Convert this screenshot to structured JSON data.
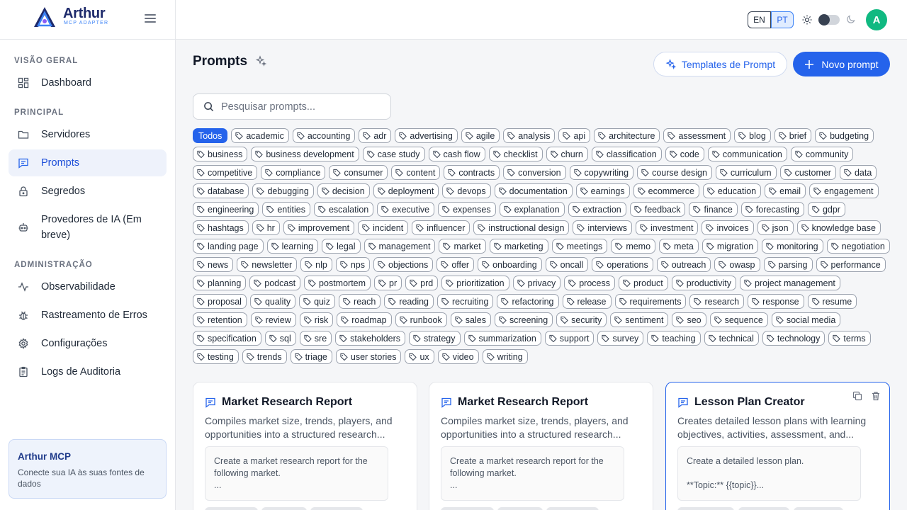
{
  "brand": {
    "name": "Arthur",
    "subtitle": "MCP ADAPTER"
  },
  "sidebar": {
    "sections": [
      {
        "label": "VISÃO GERAL"
      },
      {
        "label": "PRINCIPAL"
      },
      {
        "label": "ADMINISTRAÇÃO"
      }
    ],
    "items": [
      {
        "label": "Dashboard",
        "icon": "dashboard-icon"
      },
      {
        "label": "Servidores",
        "icon": "folder-icon"
      },
      {
        "label": "Prompts",
        "icon": "message-icon",
        "active": true
      },
      {
        "label": "Segredos",
        "icon": "lock-icon"
      },
      {
        "label": "Provedores de IA (Em breve)",
        "icon": "bot-icon"
      },
      {
        "label": "Observabilidade",
        "icon": "activity-icon"
      },
      {
        "label": "Rastreamento de Erros",
        "icon": "bug-icon"
      },
      {
        "label": "Configurações",
        "icon": "gear-icon"
      },
      {
        "label": "Logs de Auditoria",
        "icon": "clipboard-icon"
      }
    ],
    "promo": {
      "title": "Arthur MCP",
      "description": "Conecte sua IA às suas fontes de dados"
    }
  },
  "topbar": {
    "lang_en": "EN",
    "lang_pt": "PT",
    "avatar": "A"
  },
  "main": {
    "title": "Prompts",
    "templates_button": "Templates de Prompt",
    "new_button": "Novo prompt",
    "search_placeholder": "Pesquisar prompts...",
    "all_tag": "Todos",
    "tags": [
      "academic",
      "accounting",
      "adr",
      "advertising",
      "agile",
      "analysis",
      "api",
      "architecture",
      "assessment",
      "blog",
      "brief",
      "budgeting",
      "business",
      "business development",
      "case study",
      "cash flow",
      "checklist",
      "churn",
      "classification",
      "code",
      "communication",
      "community",
      "competitive",
      "compliance",
      "consumer",
      "content",
      "contracts",
      "conversion",
      "copywriting",
      "course design",
      "curriculum",
      "customer",
      "data",
      "database",
      "debugging",
      "decision",
      "deployment",
      "devops",
      "documentation",
      "earnings",
      "ecommerce",
      "education",
      "email",
      "engagement",
      "engineering",
      "entities",
      "escalation",
      "executive",
      "expenses",
      "explanation",
      "extraction",
      "feedback",
      "finance",
      "forecasting",
      "gdpr",
      "hashtags",
      "hr",
      "improvement",
      "incident",
      "influencer",
      "instructional design",
      "interviews",
      "investment",
      "invoices",
      "json",
      "knowledge base",
      "landing page",
      "learning",
      "legal",
      "management",
      "market",
      "marketing",
      "meetings",
      "memo",
      "meta",
      "migration",
      "monitoring",
      "negotiation",
      "news",
      "newsletter",
      "nlp",
      "nps",
      "objections",
      "offer",
      "onboarding",
      "oncall",
      "operations",
      "outreach",
      "owasp",
      "parsing",
      "performance",
      "planning",
      "podcast",
      "postmortem",
      "pr",
      "prd",
      "prioritization",
      "privacy",
      "process",
      "product",
      "productivity",
      "project management",
      "proposal",
      "quality",
      "quiz",
      "reach",
      "reading",
      "recruiting",
      "refactoring",
      "release",
      "requirements",
      "research",
      "response",
      "resume",
      "retention",
      "review",
      "risk",
      "roadmap",
      "runbook",
      "sales",
      "screening",
      "security",
      "sentiment",
      "seo",
      "sequence",
      "social media",
      "specification",
      "sql",
      "sre",
      "stakeholders",
      "strategy",
      "summarization",
      "support",
      "survey",
      "teaching",
      "technical",
      "technology",
      "terms",
      "testing",
      "trends",
      "triage",
      "user stories",
      "ux",
      "video",
      "writing"
    ],
    "cards": [
      {
        "title": "Market Research Report",
        "description": "Compiles market size, trends, players, and opportunities into a structured research...",
        "preview": "Create a market research report for the following market.\n..."
      },
      {
        "title": "Market Research Report",
        "description": "Compiles market size, trends, players, and opportunities into a structured research...",
        "preview": "Create a market research report for the following market.\n..."
      },
      {
        "title": "Lesson Plan Creator",
        "description": "Creates detailed lesson plans with learning objectives, activities, assessment, and...",
        "preview": "Create a detailed lesson plan.\n\n**Topic:** {{topic}}..."
      }
    ]
  },
  "colors": {
    "accent": "#2563eb",
    "avatar": "#10b981",
    "brand": "#1e2a6b"
  }
}
